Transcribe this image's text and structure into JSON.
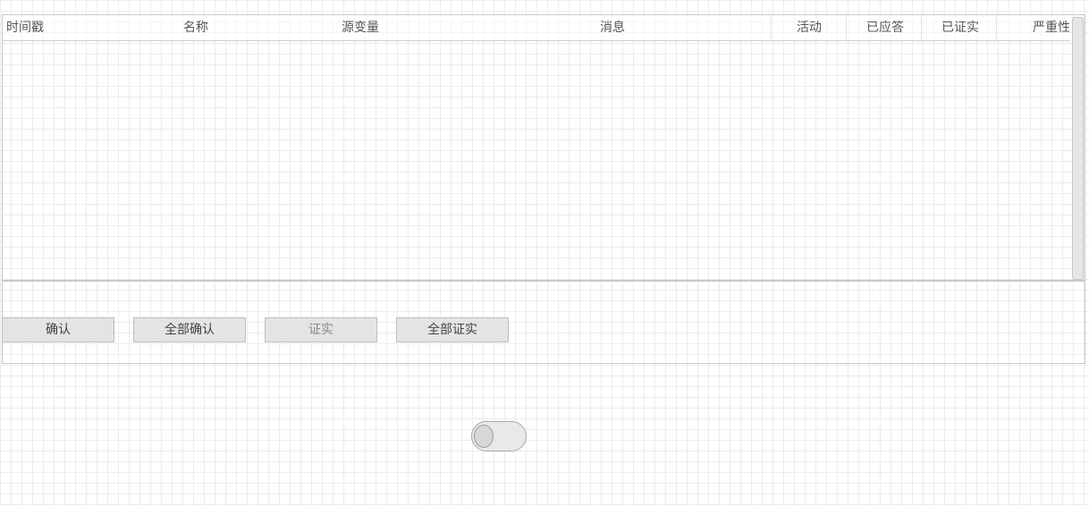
{
  "table": {
    "columns": [
      {
        "id": "timestamp",
        "label": "时间戳"
      },
      {
        "id": "name",
        "label": "名称"
      },
      {
        "id": "source",
        "label": "源变量"
      },
      {
        "id": "message",
        "label": "消息"
      },
      {
        "id": "active",
        "label": "活动"
      },
      {
        "id": "acknowledged",
        "label": "已应答"
      },
      {
        "id": "confirmed",
        "label": "已证实"
      },
      {
        "id": "severity",
        "label": "严重性"
      }
    ],
    "rows": []
  },
  "buttons": {
    "acknowledge": "确认",
    "acknowledge_all": "全部确认",
    "confirm": "证实",
    "confirm_all": "全部证实"
  },
  "toggle": {
    "state": "off"
  }
}
